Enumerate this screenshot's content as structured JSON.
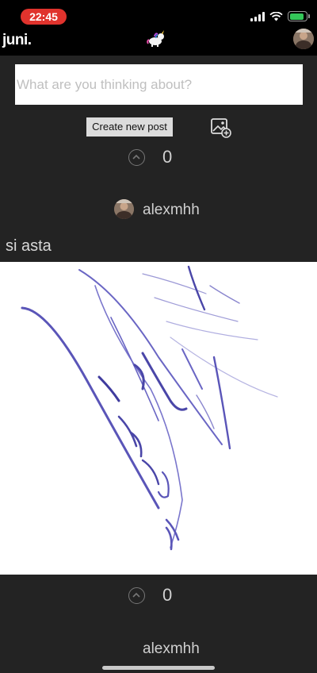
{
  "status_bar": {
    "time": "22:45"
  },
  "header": {
    "brand": "juni."
  },
  "composer": {
    "placeholder": "What are you thinking about?",
    "create_label": "Create new post"
  },
  "feed": {
    "top_vote": {
      "count": "0"
    },
    "post": {
      "author": "alexmhh",
      "text": "si asta",
      "votes": "0"
    },
    "next_post": {
      "author": "alexmhh"
    }
  },
  "icons": {
    "logo": "unicorn-icon",
    "add_photo": "add-photo-icon",
    "upvote": "upvote-icon"
  },
  "colors": {
    "accent_time": "#e0332d",
    "background": "#232323",
    "battery": "#34c759"
  }
}
